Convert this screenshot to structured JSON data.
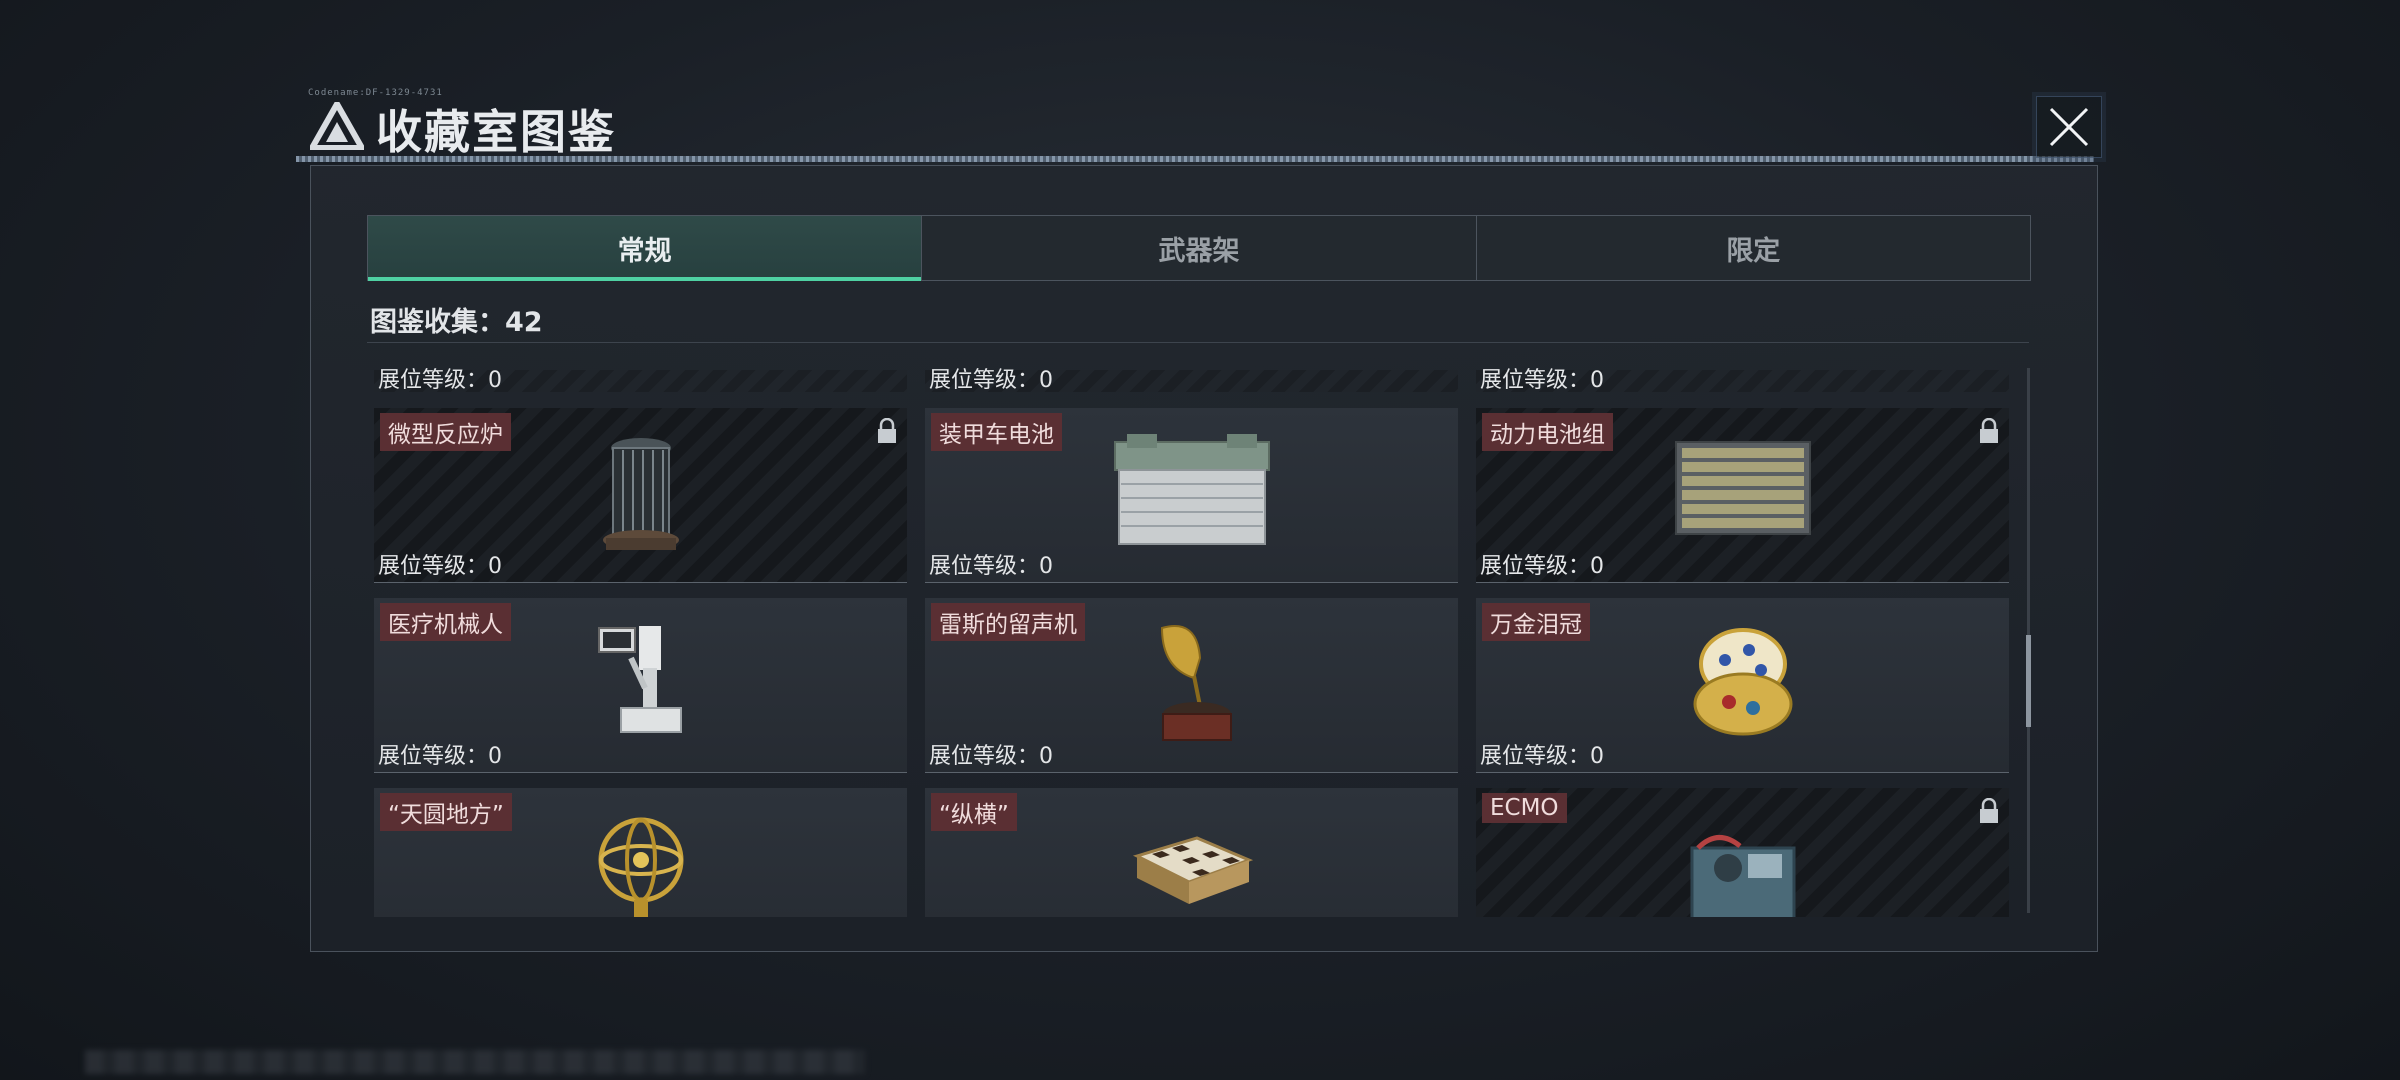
{
  "window": {
    "title": "收藏室图鉴",
    "title_small": "Codename:DF-1329-4731"
  },
  "tabs": [
    {
      "label": "常规",
      "active": true
    },
    {
      "label": "武器架",
      "active": false
    },
    {
      "label": "限定",
      "active": false
    }
  ],
  "collection": {
    "text": "图鉴收集：42"
  },
  "partial_row": [
    {
      "level_text": "展位等级：0"
    },
    {
      "level_text": "展位等级：0"
    },
    {
      "level_text": "展位等级：0"
    }
  ],
  "cards": [
    {
      "name": "微型反应炉",
      "level_text": "展位等级：0",
      "locked": true,
      "icon": "reactor-icon"
    },
    {
      "name": "装甲车电池",
      "level_text": "展位等级：0",
      "locked": false,
      "icon": "battery-icon"
    },
    {
      "name": "动力电池组",
      "level_text": "展位等级：0",
      "locked": true,
      "icon": "battery-pack-icon"
    },
    {
      "name": "医疗机械人",
      "level_text": "展位等级：0",
      "locked": false,
      "icon": "medical-robot-icon"
    },
    {
      "name": "雷斯的留声机",
      "level_text": "展位等级：0",
      "locked": false,
      "icon": "gramophone-icon"
    },
    {
      "name": "万金泪冠",
      "level_text": "展位等级：0",
      "locked": false,
      "icon": "jeweled-egg-icon"
    },
    {
      "name": "“天圆地方”",
      "level_text": "",
      "locked": false,
      "icon": "armillary-sphere-icon"
    },
    {
      "name": "“纵横”",
      "level_text": "",
      "locked": false,
      "icon": "chessboard-icon"
    },
    {
      "name": "ECMO",
      "level_text": "",
      "locked": true,
      "icon": "ecmo-machine-icon"
    }
  ],
  "colors": {
    "accent": "#4fd1a3",
    "name_tag": "#5a2f33",
    "panel_bg": "#262b32"
  }
}
